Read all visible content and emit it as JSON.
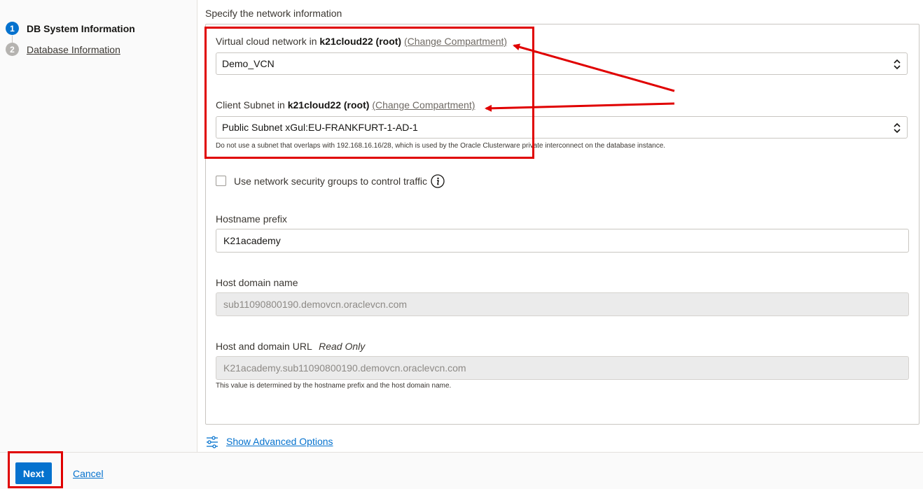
{
  "steps": [
    {
      "number": "1",
      "label": "DB System Information"
    },
    {
      "number": "2",
      "label": "Database Information"
    }
  ],
  "section": {
    "title": "Specify the network information"
  },
  "vcn": {
    "label_prefix": "Virtual cloud network in",
    "compartment": "k21cloud22 (root)",
    "change_link": "(Change Compartment)",
    "value": "Demo_VCN"
  },
  "subnet": {
    "label_prefix": "Client Subnet in",
    "compartment": "k21cloud22 (root)",
    "change_link": "(Change Compartment)",
    "value": "Public Subnet xGul:EU-FRANKFURT-1-AD-1",
    "help": "Do not use a subnet that overlaps with 192.168.16.16/28, which is used by the Oracle Clusterware private interconnect on the database instance."
  },
  "nsg": {
    "label": "Use network security groups to control traffic",
    "checked": false
  },
  "hostname": {
    "label": "Hostname prefix",
    "value": "K21academy"
  },
  "host_domain": {
    "label": "Host domain name",
    "value": "sub11090800190.demovcn.oraclevcn.com"
  },
  "host_url": {
    "label": "Host and domain URL",
    "readonly_tag": "Read Only",
    "value": "K21academy.sub11090800190.demovcn.oraclevcn.com",
    "help": "This value is determined by the hostname prefix and the host domain name."
  },
  "advanced": {
    "label": "Show Advanced Options"
  },
  "footer": {
    "next_label": "Next",
    "cancel_label": "Cancel"
  },
  "colors": {
    "accent": "#0572ce",
    "annotation": "#e00000"
  },
  "icons": [
    "chevron-updown-icon",
    "info-icon",
    "sliders-icon"
  ]
}
